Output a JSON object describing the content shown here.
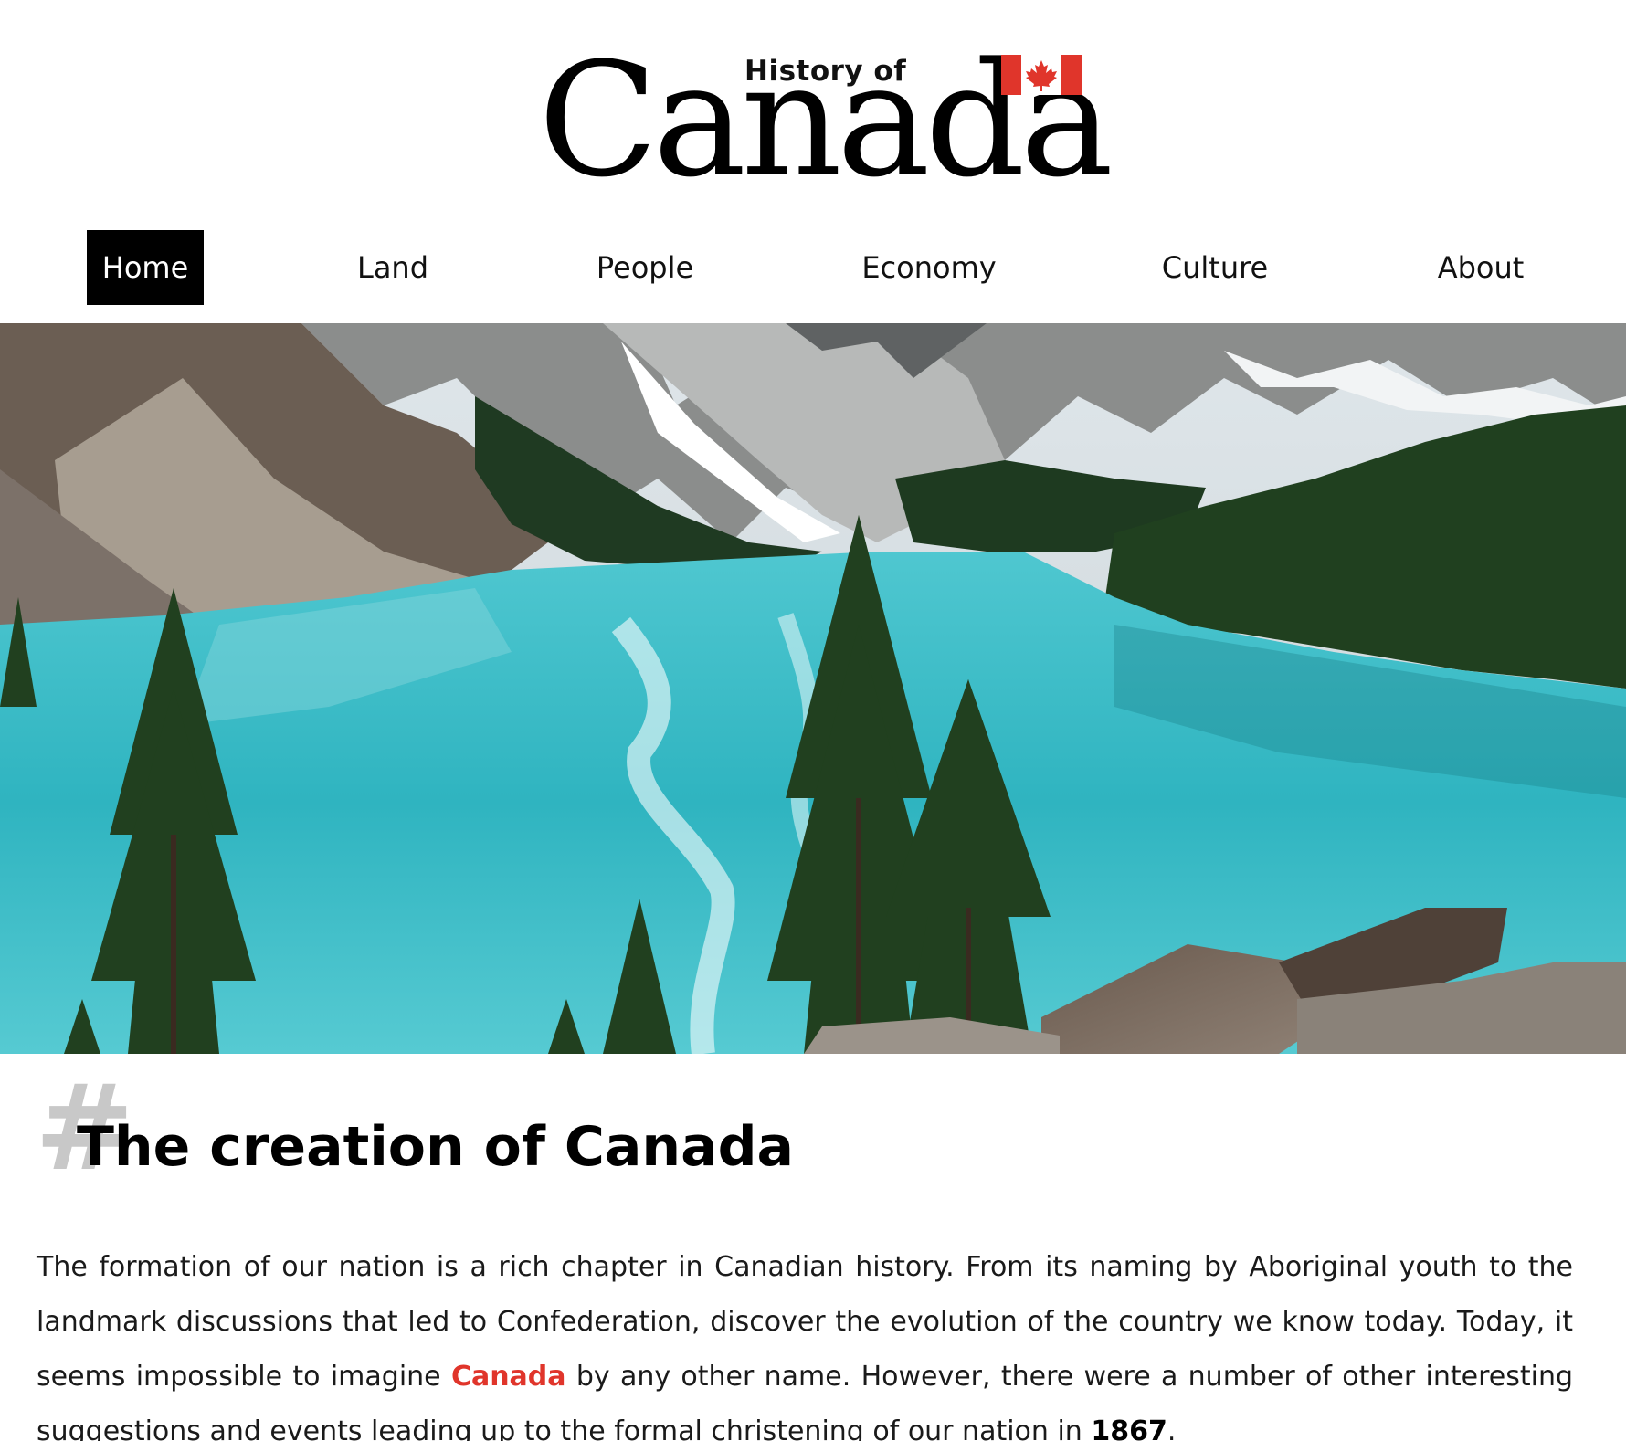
{
  "header": {
    "logo_small": "History of",
    "logo_big": "Canada",
    "flag_icon": "canada-flag-icon",
    "flag_colors": {
      "red": "#e0352b",
      "white": "#ffffff"
    }
  },
  "nav": {
    "items": [
      {
        "label": "Home",
        "active": true
      },
      {
        "label": "Land",
        "active": false
      },
      {
        "label": "People",
        "active": false
      },
      {
        "label": "Economy",
        "active": false
      },
      {
        "label": "Culture",
        "active": false
      },
      {
        "label": "About",
        "active": false
      }
    ]
  },
  "hero": {
    "scene": "mountain-lake-landscape"
  },
  "article": {
    "hash_symbol": "#",
    "heading": "The creation of Canada",
    "paragraph": {
      "part1": "The formation of our nation is a rich chapter in Canadian history. From its naming by Aboriginal youth to the landmark discussions that led to Confederation, discover the evolution of the country we know today. Today, it seems impossible to imagine ",
      "highlight": "Canada",
      "part2": " by any other name. However, there were a number of other interesting suggestions and events leading up to the formal christening of our nation in ",
      "year": "1867",
      "part3": "."
    }
  },
  "colors": {
    "accent": "#e0352b",
    "nav_active_bg": "#000000",
    "nav_active_text": "#ffffff",
    "lake": "#3ec3cc"
  }
}
